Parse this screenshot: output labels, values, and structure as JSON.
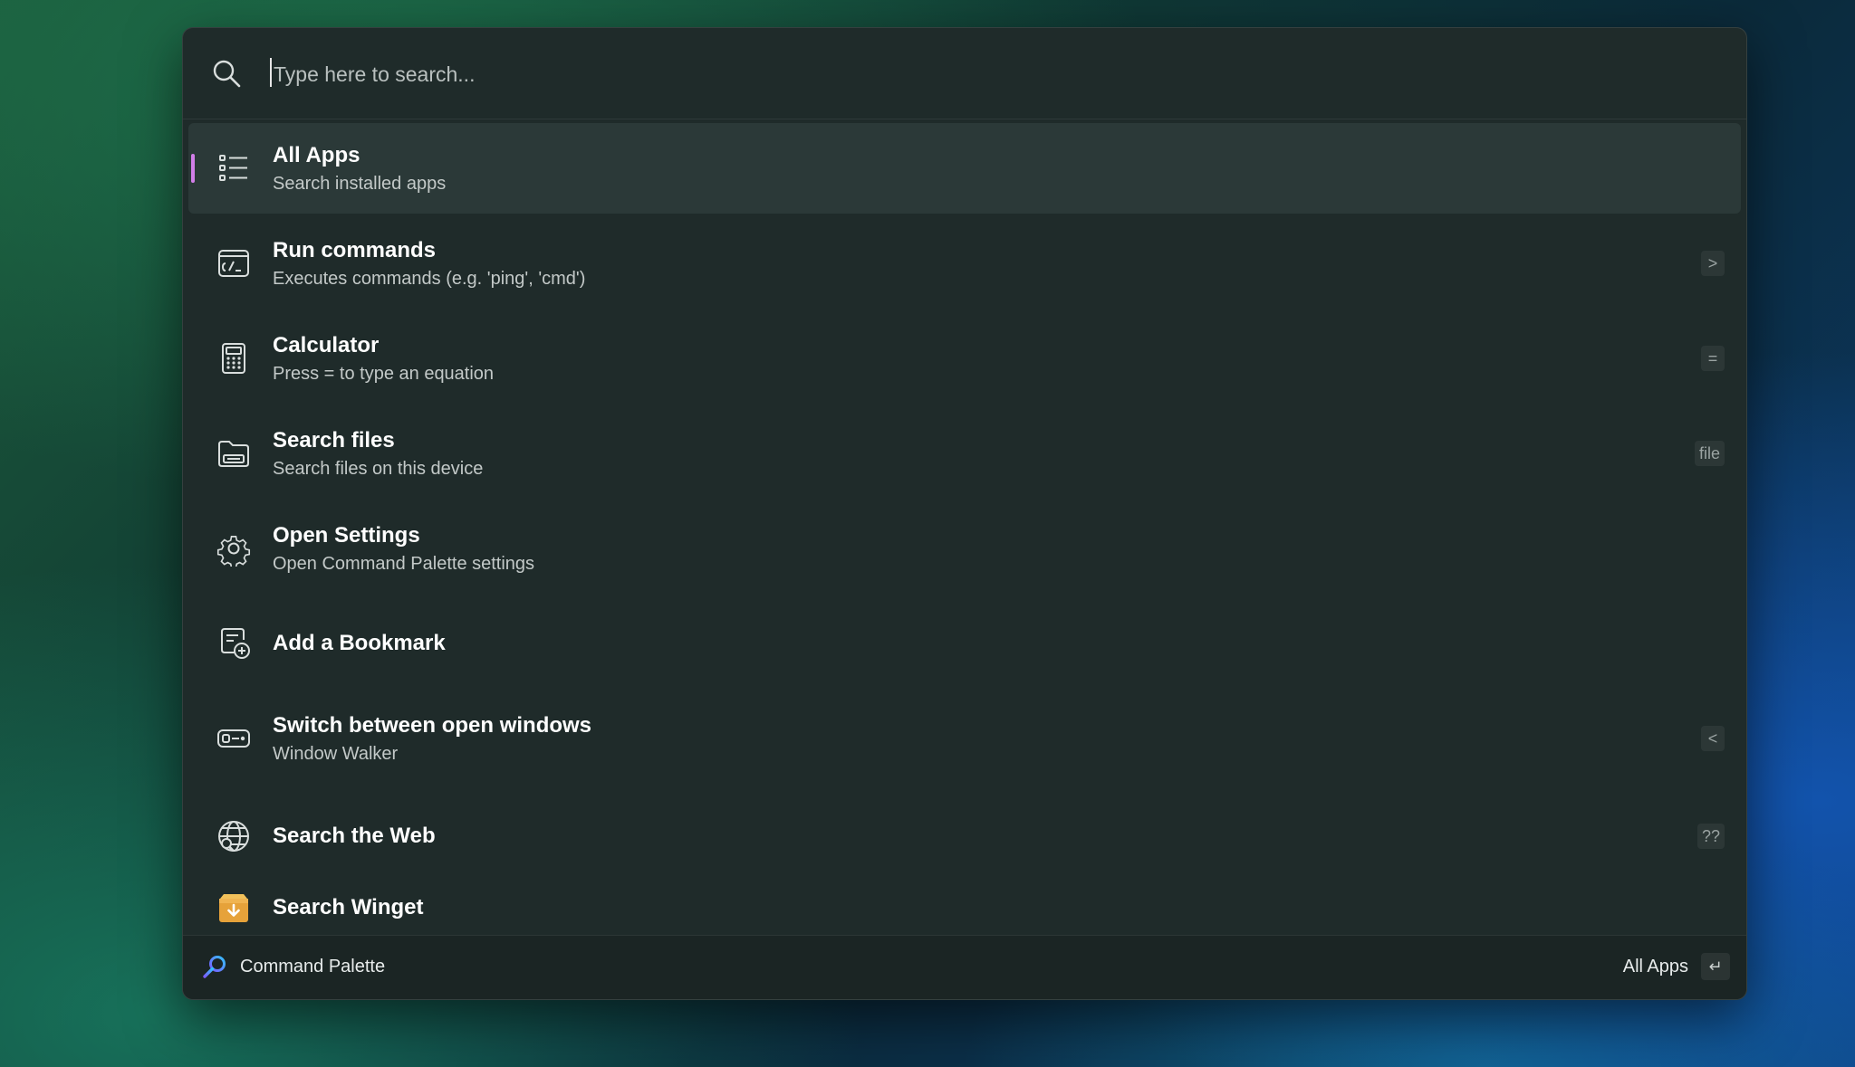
{
  "search": {
    "placeholder": "Type here to search..."
  },
  "items": [
    {
      "title": "All Apps",
      "subtitle": "Search installed apps",
      "icon": "list-icon",
      "shortcut": "",
      "selected": true
    },
    {
      "title": "Run commands",
      "subtitle": "Executes commands (e.g. 'ping', 'cmd')",
      "icon": "terminal-icon",
      "shortcut": ">"
    },
    {
      "title": "Calculator",
      "subtitle": "Press = to type an equation",
      "icon": "calculator-icon",
      "shortcut": "="
    },
    {
      "title": "Search files",
      "subtitle": "Search files on this device",
      "icon": "folder-icon",
      "shortcut": "file"
    },
    {
      "title": "Open Settings",
      "subtitle": "Open Command Palette settings",
      "icon": "gear-icon",
      "shortcut": ""
    },
    {
      "title": "Add a Bookmark",
      "subtitle": "",
      "icon": "bookmark-add-icon",
      "shortcut": ""
    },
    {
      "title": "Switch between open windows",
      "subtitle": "Window Walker",
      "icon": "window-switch-icon",
      "shortcut": "<"
    },
    {
      "title": "Search the Web",
      "subtitle": "",
      "icon": "globe-icon",
      "shortcut": "??"
    },
    {
      "title": "Search Winget",
      "subtitle": "",
      "icon": "winget-package-icon",
      "shortcut": ""
    }
  ],
  "footer": {
    "app_name": "Command Palette",
    "action_label": "All Apps",
    "action_key": "↵"
  },
  "colors": {
    "accent": "#d27ee8",
    "panel": "#1f2b2a",
    "selected": "#2b3938"
  }
}
